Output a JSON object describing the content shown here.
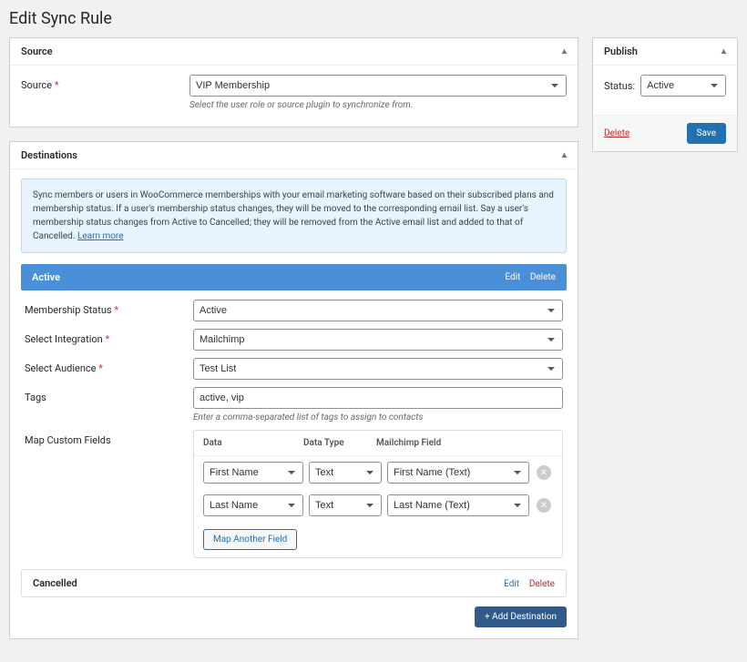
{
  "page": {
    "title": "Edit Sync Rule"
  },
  "source": {
    "panel_title": "Source",
    "label": "Source",
    "value": "VIP Membership",
    "hint": "Select the user role or source plugin to synchronize from."
  },
  "destinations": {
    "panel_title": "Destinations",
    "info_text": "Sync members or users in WooCommerce memberships with your email marketing software based on their subscribed plans and membership status. If a user's membership status changes, they will be moved to the corresponding email list. Say a user's membership status changes from Active to Cancelled; they will be removed from the Active email list and added to that of Cancelled.",
    "learn_more": "Learn more",
    "active": {
      "title": "Active",
      "edit": "Edit",
      "delete": "Delete",
      "membership_status": {
        "label": "Membership Status",
        "value": "Active"
      },
      "integration": {
        "label": "Select Integration",
        "value": "Mailchimp"
      },
      "audience": {
        "label": "Select Audience",
        "value": "Test List"
      },
      "tags": {
        "label": "Tags",
        "value": "active, vip",
        "hint": "Enter a comma-separated list of tags to assign to contacts"
      },
      "map": {
        "label": "Map Custom Fields",
        "headers": {
          "data": "Data",
          "type": "Data Type",
          "field": "Mailchimp Field"
        },
        "rows": [
          {
            "data": "First Name",
            "type": "Text",
            "field": "First Name (Text)"
          },
          {
            "data": "Last Name",
            "type": "Text",
            "field": "Last Name (Text)"
          }
        ],
        "another": "Map Another Field"
      }
    },
    "cancelled": {
      "title": "Cancelled",
      "edit": "Edit",
      "delete": "Delete"
    },
    "add_button": "+ Add Destination"
  },
  "publish": {
    "panel_title": "Publish",
    "status_label": "Status:",
    "status_value": "Active",
    "delete": "Delete",
    "save": "Save"
  }
}
